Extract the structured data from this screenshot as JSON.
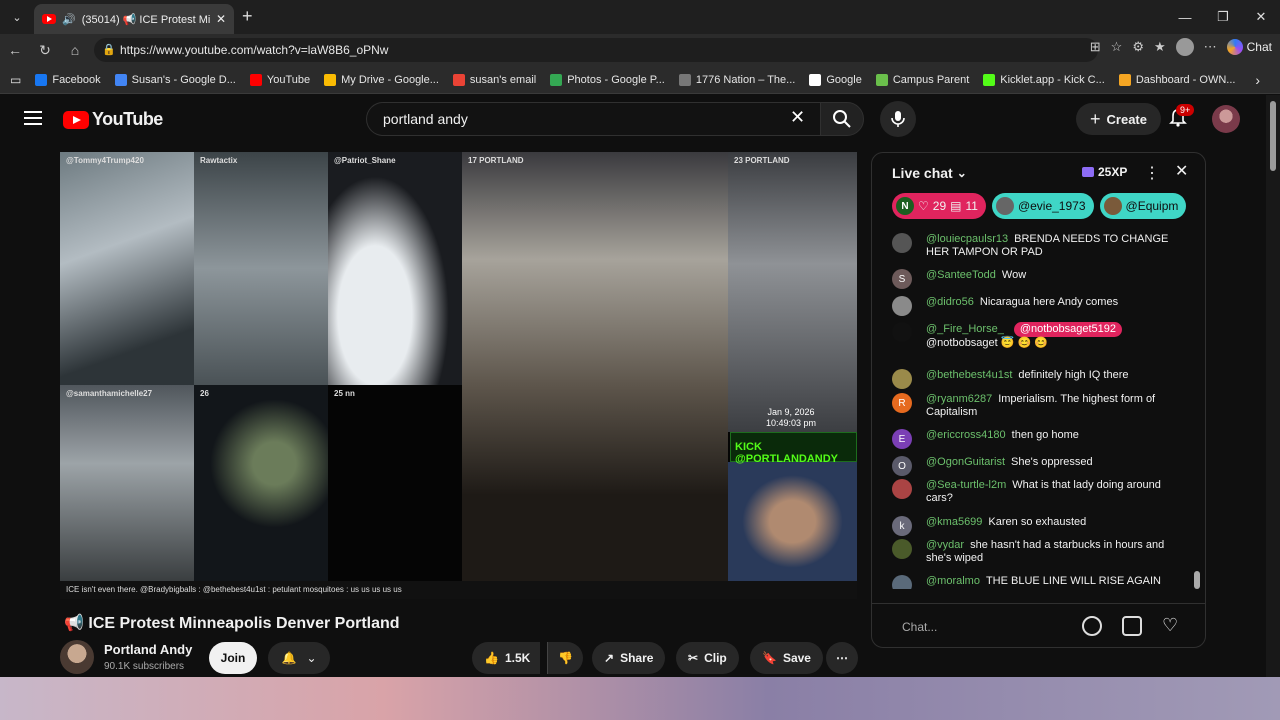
{
  "browser": {
    "tab_title": "(35014) 📢 ICE Protest Minnea",
    "url": "https://www.youtube.com/watch?v=laW8B6_oPNw",
    "copilot_label": "Chat"
  },
  "bookmarks": [
    {
      "label": "Facebook",
      "color": "#1877f2"
    },
    {
      "label": "Susan's - Google D...",
      "color": "#4285f4"
    },
    {
      "label": "YouTube",
      "color": "#ff0000"
    },
    {
      "label": "My Drive - Google...",
      "color": "#fbbc04"
    },
    {
      "label": "susan's email",
      "color": "#ea4335"
    },
    {
      "label": "Photos - Google P...",
      "color": "#34a853"
    },
    {
      "label": "1776 Nation – The...",
      "color": "#777777"
    },
    {
      "label": "Google",
      "color": "#ffffff"
    },
    {
      "label": "Campus Parent",
      "color": "#6abf4b"
    },
    {
      "label": "Kicklet.app - Kick C...",
      "color": "#53fc18"
    },
    {
      "label": "Dashboard - OWN...",
      "color": "#f5a623"
    }
  ],
  "youtube": {
    "logo": "YouTube",
    "search_query": "portland andy",
    "create_label": "Create",
    "notif_badge": "9+"
  },
  "video": {
    "cells": [
      {
        "label": "@Tommy4Trump420"
      },
      {
        "label": "Rawtactix"
      },
      {
        "label": "@Patriot_Shane"
      },
      {
        "label": "17 PORTLAND"
      },
      {
        "label": "23 PORTLAND"
      },
      {
        "label": "@samanthamichelle27"
      },
      {
        "label": "26"
      },
      {
        "label": "25 nn"
      }
    ],
    "timestamp_date": "Jan 9, 2026",
    "timestamp_time": "10:49:03 pm",
    "kick_label": "KICK @PORTLANDANDY",
    "ticker": "ICE isn't even there.  @Bradybigballs :  @bethebest4u1st : petulant mosquitoes  : us us us us us"
  },
  "title": "📢 ICE Protest Minneapolis Denver Portland",
  "channel": {
    "name": "Portland Andy",
    "subs": "90.1K subscribers",
    "join": "Join"
  },
  "actions": {
    "likes": "1.5K",
    "share": "Share",
    "clip": "Clip",
    "save": "Save"
  },
  "chat": {
    "header": "Live chat",
    "xp": "25XP",
    "chips": [
      {
        "icon": "N",
        "a": "29",
        "b": "11",
        "color": "#e0245e"
      },
      {
        "label": "@evie_1973",
        "color": "#3fd6c6"
      },
      {
        "label": "@Equipm",
        "color": "#3fd6c6"
      }
    ],
    "messages": [
      {
        "user": "@louiecpaulsr13",
        "text": "BRENDA NEEDS TO CHANGE HER TAMPON OR PAD",
        "avatar_color": "#555555",
        "letter": ""
      },
      {
        "user": "@SanteeTodd",
        "text": "Wow",
        "avatar_color": "#6d5a5a",
        "letter": "S"
      },
      {
        "user": "@didro56",
        "text": "Nicaragua here Andy comes",
        "avatar_color": "#8a8a8a",
        "letter": ""
      },
      {
        "user": "@_Fire_Horse_",
        "mention": "@notbobsaget5192",
        "text": "@notbobsaget 😇 😊 😊",
        "avatar_color": "#111111",
        "letter": ""
      },
      {
        "user": "@bethebest4u1st",
        "text": "definitely high IQ there",
        "avatar_color": "#9a8a4a",
        "letter": ""
      },
      {
        "user": "@ryanm6287",
        "text": "Imperialism. The highest form of Capitalism",
        "avatar_color": "#e66a1f",
        "letter": "R"
      },
      {
        "user": "@ericcross4180",
        "text": "then go home",
        "avatar_color": "#7b3fb5",
        "letter": "E"
      },
      {
        "user": "@OgonGuitarist",
        "text": "She's oppressed",
        "avatar_color": "#5a5a6a",
        "letter": "O"
      },
      {
        "user": "@Sea-turtle-l2m",
        "text": "What is that lady doing around cars?",
        "avatar_color": "#aa4444",
        "letter": ""
      },
      {
        "user": "@kma5699",
        "text": "Karen so exhausted",
        "avatar_color": "#6a6a7a",
        "letter": "k"
      },
      {
        "user": "@vydar",
        "text": "she hasn't had a starbucks in hours and she's wiped",
        "avatar_color": "#4a5a2a",
        "letter": ""
      },
      {
        "user": "@moralmo",
        "text": "THE BLUE LINE WILL RISE AGAIN",
        "avatar_color": "#5a6a7a",
        "letter": ""
      }
    ],
    "input_placeholder": "Chat..."
  }
}
